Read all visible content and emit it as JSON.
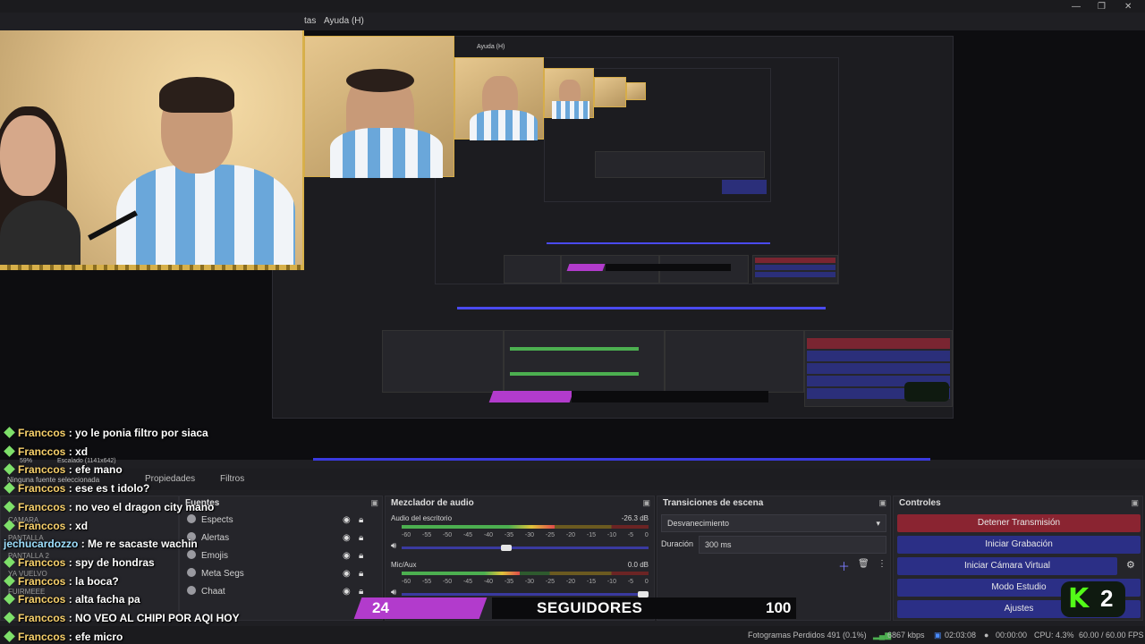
{
  "menu": {
    "herramientas": "tas",
    "ayuda": "Ayuda (H)"
  },
  "window_controls": {
    "min": "—",
    "max": "❐",
    "close": "✕"
  },
  "nested_menu": {
    "ayuda": "Ayuda (H)"
  },
  "chat": [
    {
      "user": "Franccos",
      "msg": ": yo le ponia filtro por siaca"
    },
    {
      "user": "Franccos",
      "msg": ": xd"
    },
    {
      "user": "Franccos",
      "msg": ": efe mano"
    },
    {
      "user": "Franccos",
      "msg": ": ese es t idolo?"
    },
    {
      "user": "Franccos",
      "msg": ": no veo el dragon city mano"
    },
    {
      "user": "Franccos",
      "msg": ": xd"
    },
    {
      "user": "jechucardozzo",
      "msg": ": Me re sacaste wachin"
    },
    {
      "user": "Franccos",
      "msg": ": spy de hondras"
    },
    {
      "user": "Franccos",
      "msg": ": la boca?"
    },
    {
      "user": "Franccos",
      "msg": ": alta facha pa"
    },
    {
      "user": "Franccos",
      "msg": ": NO VEO AL CHIPI POR AQI HOY"
    },
    {
      "user": "Franccos",
      "msg": ": efe micro"
    }
  ],
  "dock": {
    "zoom": "59%",
    "scale": "Escalado (1141x642)",
    "no_source": "Ninguna fuente seleccionada",
    "tab_props": "Propiedades",
    "tab_filters": "Filtros"
  },
  "scenes": {
    "items": [
      "CAMARA",
      "PANTALLA",
      "PANTALLA 2",
      "YA VUELVO",
      "FUIRMEEE"
    ]
  },
  "sources": {
    "title": "Fuentes",
    "items": [
      "Espects",
      "Alertas",
      "Emojis",
      "Meta Segs",
      "Chaat"
    ]
  },
  "mixer": {
    "title": "Mezclador de audio",
    "ch1_name": "Audio del escritorio",
    "ch1_db": "-26.3 dB",
    "ch1_level": 0.62,
    "ch1_volume": 0.42,
    "ch2_name": "Mic/Aux",
    "ch2_db": "0.0 dB",
    "ch2_level": 0.48,
    "ch2_volume": 1.0,
    "ticks": [
      "-60",
      "-55",
      "-50",
      "-45",
      "-40",
      "-35",
      "-30",
      "-25",
      "-20",
      "-15",
      "-10",
      "-5",
      "0"
    ]
  },
  "transitions": {
    "title": "Transiciones de escena",
    "selected": "Desvanecimiento",
    "duration_label": "Duración",
    "duration_value": "300 ms"
  },
  "controls": {
    "title": "Controles",
    "stop_stream": "Detener Transmisión",
    "start_recording": "Iniciar Grabación",
    "start_vcam": "Iniciar Cámara Virtual",
    "studio_mode": "Modo Estudio",
    "settings": "Ajustes"
  },
  "followers": {
    "count": "24",
    "label": "SEGUIDORES",
    "goal": "100"
  },
  "kick_badge": {
    "letter": "K",
    "number": "2"
  },
  "status": {
    "dropped": "Fotogramas Perdidos 491 (0.1%)",
    "kbps": "6867 kbps",
    "stream_time": "02:03:08",
    "rec_time": "00:00:00",
    "cpu": "CPU: 4.3%",
    "fps": "60.00 / 60.00 FPS"
  },
  "colors": {
    "accent_purple": "#b23bcc",
    "stop_red": "#8a2431",
    "button_blue": "#2b2f86",
    "kick_green": "#53fc18",
    "chat_diamond": "#7ee06a"
  }
}
